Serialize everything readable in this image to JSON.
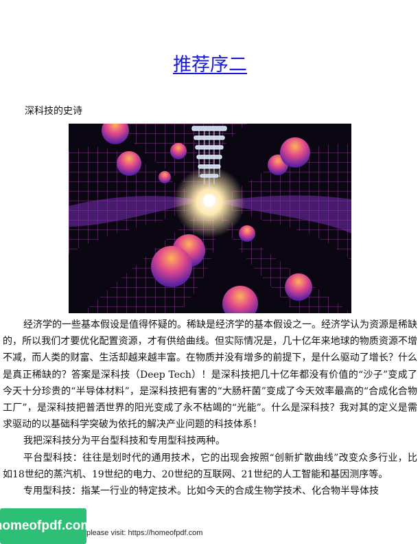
{
  "page": {
    "title": "推荐序二",
    "subtitle": "深科技的史诗",
    "figure": {
      "description": "Abstract illustration: a glowing white core with a stacked column of rings above it, purple-grid warped space, and magenta-orange spheres",
      "colors": {
        "background": "#0a0612",
        "grid": "#d760d8",
        "sphere_top": "#ff7a2e",
        "sphere_bottom": "#6a2ac8",
        "glow": "#fff6d6"
      }
    },
    "paragraphs": [
      "经济学的一些基本假设是值得怀疑的。稀缺是经济学的基本假设之一。经济学认为资源是稀缺的，所以我们才要优化配置资源，才有供给曲线。但实际情况是，几十亿年来地球的物质资源不增不减，而人类的财富、生活却越来越丰富。在物质并没有增多的前提下，是什么驱动了增长？什么是真正稀缺的？答案是深科技（Deep Tech）！是深科技把几十亿年都没有价值的“沙子”变成了今天十分珍贵的“半导体材料”，是深科技把有害的“大肠杆菌”变成了今天效率最高的“合成化合物工厂”，是深科技把普洒世界的阳光变成了永不枯竭的“光能”。什么是深科技？我对其的定义是需求驱动的以基础科学突破为依托的解决产业问题的科技体系！",
      "我把深科技分为平台型科技和专用型科技两种。",
      "平台型科技：往往是划时代的通用技术，它的出现会按照“创新扩散曲线”改变众多行业，比如18世纪的蒸汽机、19世纪的电力、20世纪的互联网、21世纪的人工智能和基因测序等。",
      "专用型科技：指某一行业的特定技术。比如今天的合成生物学技术、化合物半导体技"
    ],
    "watermark": {
      "logo_text": "homeofpdf.com",
      "note": "please visit: https://homeofpdf.com"
    }
  }
}
